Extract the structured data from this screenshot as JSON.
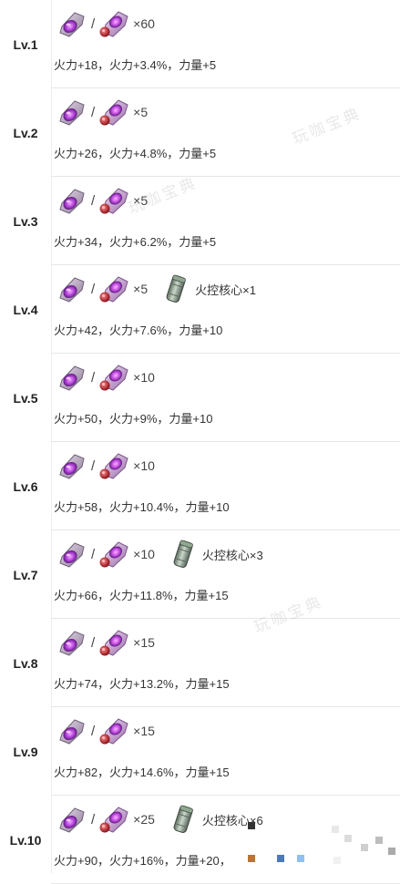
{
  "rows": [
    {
      "level": "Lv.1",
      "qty": "×60",
      "core": "",
      "stats": "火力+18，火力+3.4%，力量+5"
    },
    {
      "level": "Lv.2",
      "qty": "×5",
      "core": "",
      "stats": "火力+26，火力+4.8%，力量+5"
    },
    {
      "level": "Lv.3",
      "qty": "×5",
      "core": "",
      "stats": "火力+34，火力+6.2%，力量+5"
    },
    {
      "level": "Lv.4",
      "qty": "×5",
      "core": "火控核心×1",
      "stats": "火力+42，火力+7.6%，力量+10"
    },
    {
      "level": "Lv.5",
      "qty": "×10",
      "core": "",
      "stats": "火力+50，火力+9%，力量+10"
    },
    {
      "level": "Lv.6",
      "qty": "×10",
      "core": "",
      "stats": "火力+58，火力+10.4%，力量+10"
    },
    {
      "level": "Lv.7",
      "qty": "×10",
      "core": "火控核心×3",
      "stats": "火力+66，火力+11.8%，力量+15"
    },
    {
      "level": "Lv.8",
      "qty": "×15",
      "core": "",
      "stats": "火力+74，火力+13.2%，力量+15"
    },
    {
      "level": "Lv.9",
      "qty": "×15",
      "core": "",
      "stats": "火力+82，火力+14.6%，力量+15"
    },
    {
      "level": "Lv.10",
      "qty": "×25",
      "core": "火控核心×6",
      "stats": "火力+90，火力+16%，力量+20，"
    }
  ],
  "separator": "/",
  "watermark": "玩咖宝典",
  "icons": {
    "material_a": "purple-gem-chip-icon",
    "material_b": "purple-gem-red-ball-icon",
    "core": "fire-control-core-canister-icon"
  },
  "colors": {
    "text": "#333333",
    "level_text": "#222222",
    "gem_purple": "#b040d8",
    "gem_red": "#c0202a",
    "canister_green": "#8fa88f",
    "divider": "#e6e6e6"
  }
}
